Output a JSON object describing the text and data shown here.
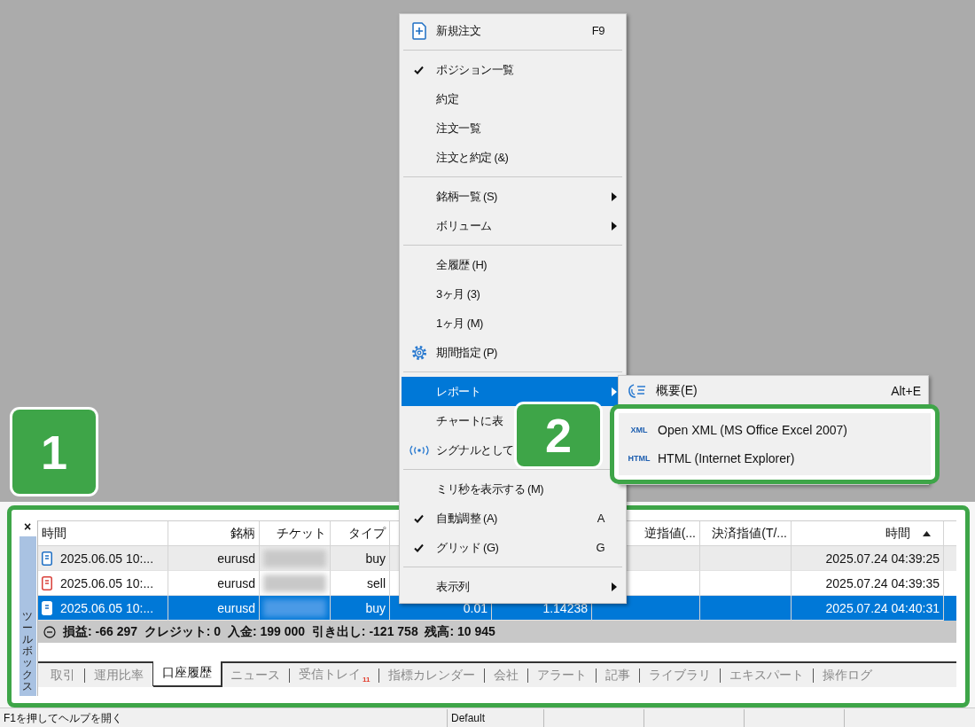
{
  "menu": {
    "items": [
      {
        "kind": "item",
        "label": "新規注文",
        "shortcut": "F9",
        "checked": false,
        "submenu": false,
        "selected": false
      },
      {
        "kind": "separator"
      },
      {
        "kind": "item",
        "label": "ポジション一覧",
        "checked": true,
        "submenu": false,
        "selected": false
      },
      {
        "kind": "item",
        "label": "約定",
        "checked": false,
        "submenu": false,
        "selected": false
      },
      {
        "kind": "item",
        "label": "注文一覧",
        "checked": false,
        "submenu": false,
        "selected": false
      },
      {
        "kind": "item",
        "label": "注文と約定 (&)",
        "checked": false,
        "submenu": false,
        "selected": false
      },
      {
        "kind": "separator"
      },
      {
        "kind": "item",
        "label": "銘柄一覧 (S)",
        "checked": false,
        "submenu": true,
        "selected": false
      },
      {
        "kind": "item",
        "label": "ボリューム",
        "checked": false,
        "submenu": true,
        "selected": false
      },
      {
        "kind": "separator"
      },
      {
        "kind": "item",
        "label": "全履歴 (H)",
        "checked": false,
        "submenu": false,
        "selected": false
      },
      {
        "kind": "item",
        "label": "3ヶ月 (3)",
        "checked": false,
        "submenu": false,
        "selected": false
      },
      {
        "kind": "item",
        "label": "1ヶ月 (M)",
        "checked": false,
        "submenu": false,
        "selected": false
      },
      {
        "kind": "item",
        "label": "期間指定 (P)",
        "checked": false,
        "submenu": false,
        "selected": false
      },
      {
        "kind": "separator"
      },
      {
        "kind": "item",
        "label": "レポート",
        "checked": false,
        "submenu": true,
        "selected": true
      },
      {
        "kind": "item",
        "label": "チャートに表",
        "checked": false,
        "selected": false
      },
      {
        "kind": "item",
        "label": "シグナルとして",
        "checked": false,
        "selected": false
      },
      {
        "kind": "separator"
      },
      {
        "kind": "item",
        "label": "ミリ秒を表示する (M)",
        "checked": false,
        "submenu": false,
        "selected": false
      },
      {
        "kind": "item",
        "label": "自動調整 (A)",
        "shortcut": "A",
        "checked": true,
        "submenu": false,
        "selected": false
      },
      {
        "kind": "item",
        "label": "グリッド (G)",
        "shortcut": "G",
        "checked": true,
        "submenu": false,
        "selected": false
      },
      {
        "kind": "separator"
      },
      {
        "kind": "item",
        "label": "表示列",
        "checked": false,
        "submenu": true,
        "selected": false
      }
    ]
  },
  "report_submenu": {
    "items": [
      {
        "kind": "item",
        "label": "概要(E)",
        "shortcut": "Alt+E"
      },
      {
        "kind": "export",
        "badge": "XML",
        "label": "Open XML (MS Office Excel 2007)"
      },
      {
        "kind": "export",
        "badge": "HTML",
        "label": "HTML (Internet Explorer)"
      }
    ]
  },
  "toolbox": {
    "close": "×",
    "title": "ツールボックス"
  },
  "table": {
    "columns": [
      {
        "label": "時間",
        "sorted": false,
        "redacted": false
      },
      {
        "label": "銘柄",
        "sorted": false,
        "redacted": false
      },
      {
        "label": "チケット",
        "sorted": false,
        "redacted": true
      },
      {
        "label": "タイプ",
        "sorted": false,
        "redacted": false
      },
      null,
      null,
      {
        "label": "逆指値(...",
        "sorted": false,
        "redacted": false
      },
      {
        "label": "決済指値(T/...",
        "sorted": false,
        "redacted": false
      },
      {
        "label": "時間",
        "sorted": true,
        "redacted": false
      }
    ],
    "rows": [
      {
        "kind": "buy",
        "selected": false,
        "cells": [
          "2025.06.05 10:...",
          "eurusd",
          null,
          "buy",
          null,
          null,
          null,
          null,
          "2025.07.24 04:39:25"
        ]
      },
      {
        "kind": "sell",
        "selected": false,
        "cells": [
          "2025.06.05 10:...",
          "eurusd",
          null,
          "sell",
          null,
          null,
          null,
          null,
          "2025.07.24 04:39:35"
        ]
      },
      {
        "kind": "buy",
        "selected": true,
        "cells": [
          "2025.06.05 10:...",
          "eurusd",
          null,
          "buy",
          "0.01",
          "1.14238",
          null,
          null,
          "2025.07.24 04:40:31"
        ]
      }
    ],
    "summary": {
      "expanded": true,
      "text": "損益: -66 297  クレジット: 0  入金: 199 000  引き出し: -121 758  残高: 10 945"
    }
  },
  "tabs": [
    {
      "label": "取引",
      "selected": false
    },
    {
      "label": "運用比率",
      "selected": false
    },
    {
      "label": "口座履歴",
      "selected": true
    },
    {
      "label": "ニュース",
      "selected": false
    },
    {
      "label": "受信トレイ",
      "badge": "11",
      "selected": false
    },
    {
      "label": "指標カレンダー",
      "selected": false
    },
    {
      "label": "会社",
      "selected": false
    },
    {
      "label": "アラート",
      "selected": false
    },
    {
      "label": "記事",
      "selected": false
    },
    {
      "label": "ライブラリ",
      "selected": false
    },
    {
      "label": "エキスパート",
      "selected": false
    },
    {
      "label": "操作ログ",
      "selected": false
    }
  ],
  "status_bar": [
    "F1を押してヘルプを開く",
    "Default"
  ],
  "annotations": [
    {
      "label": "1"
    },
    {
      "label": "2"
    }
  ]
}
